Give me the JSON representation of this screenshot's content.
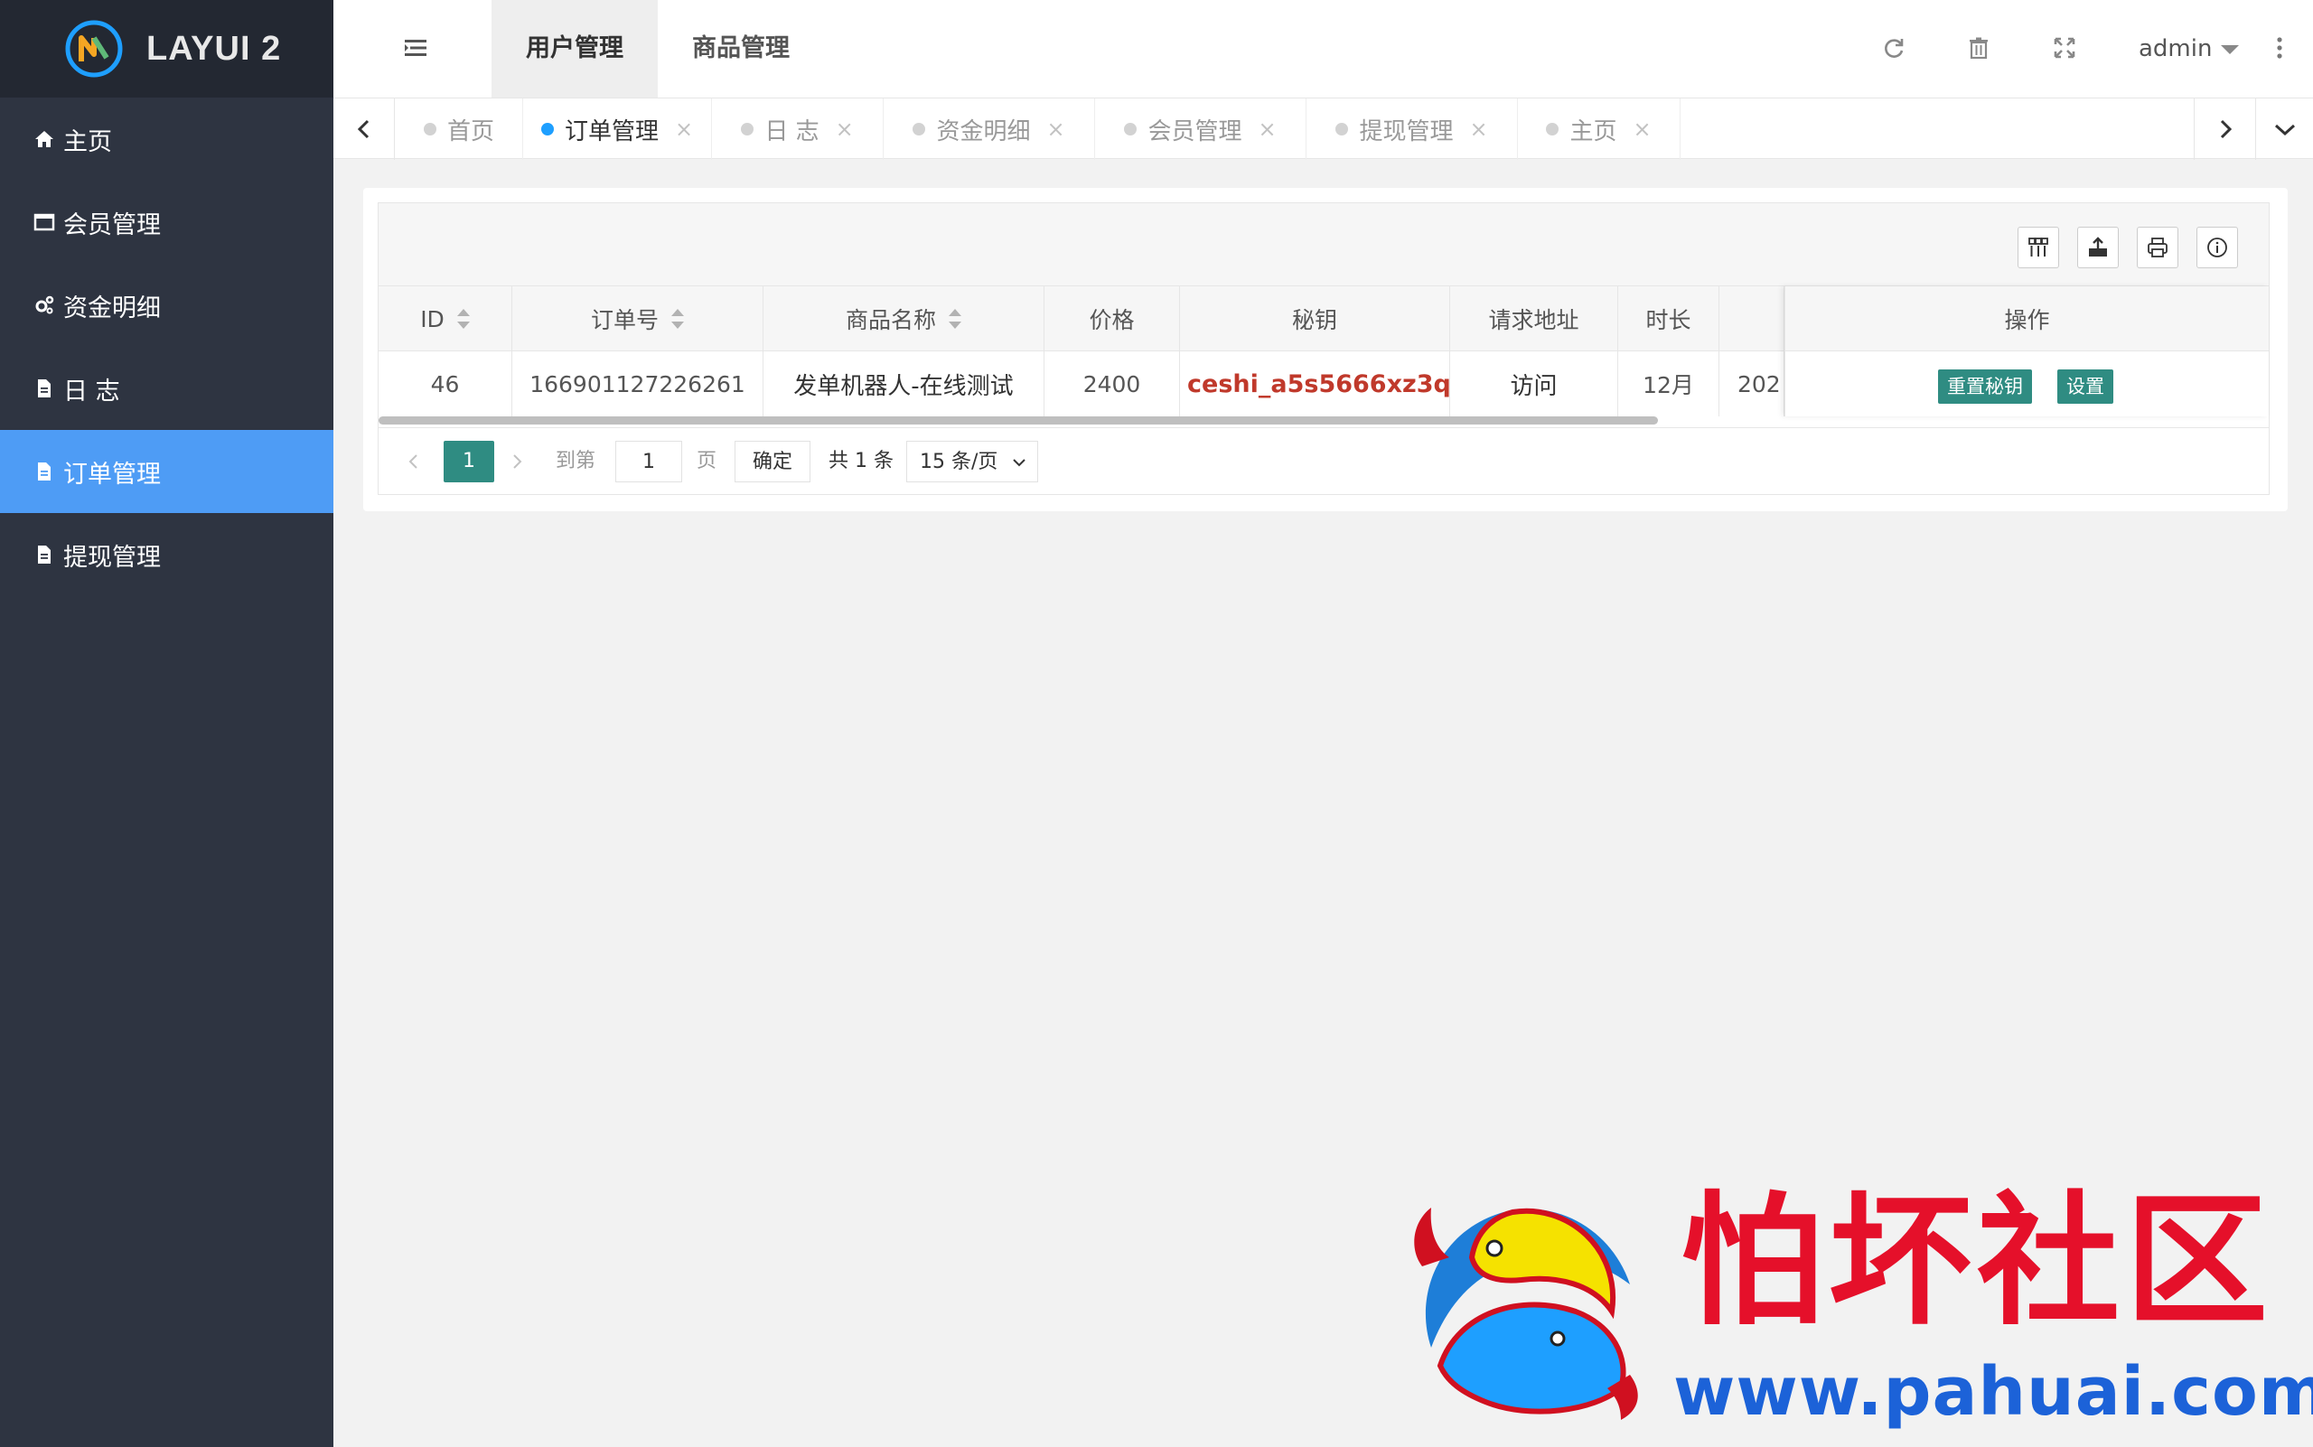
{
  "app": {
    "brand": "LAYUI 2"
  },
  "sidebar": {
    "items": [
      {
        "label": "主页",
        "icon": "home-icon",
        "active": false
      },
      {
        "label": "会员管理",
        "icon": "window-icon",
        "active": false
      },
      {
        "label": "资金明细",
        "icon": "gears-icon",
        "active": false
      },
      {
        "label": "日 志",
        "icon": "file-icon",
        "active": false
      },
      {
        "label": "订单管理",
        "icon": "file-icon",
        "active": true
      },
      {
        "label": "提现管理",
        "icon": "file-icon",
        "active": false
      }
    ]
  },
  "header": {
    "tabs": [
      {
        "label": "用户管理",
        "active": true
      },
      {
        "label": "商品管理",
        "active": false
      }
    ],
    "user": "admin",
    "icons": [
      "refresh-icon",
      "trash-icon",
      "fullscreen-icon",
      "more-icon"
    ]
  },
  "page_tabs": [
    {
      "label": "首页",
      "closable": false,
      "active": false
    },
    {
      "label": "订单管理",
      "closable": true,
      "active": true
    },
    {
      "label": "日 志",
      "closable": true,
      "active": false
    },
    {
      "label": "资金明细",
      "closable": true,
      "active": false
    },
    {
      "label": "会员管理",
      "closable": true,
      "active": false
    },
    {
      "label": "提现管理",
      "closable": true,
      "active": false
    },
    {
      "label": "主页",
      "closable": true,
      "active": false
    }
  ],
  "table": {
    "toolbar_icons": [
      "columns-icon",
      "export-icon",
      "print-icon",
      "info-icon"
    ],
    "columns": [
      "ID",
      "订单号",
      "商品名称",
      "价格",
      "秘钥",
      "请求地址",
      "时长",
      "",
      "操作"
    ],
    "rows": [
      {
        "id": "46",
        "order_no": "166901127226261",
        "product": "发单机器人-在线测试",
        "price": "2400",
        "secret": "ceshi_a5s5666xz3q...",
        "url": "访问",
        "duration": "12月",
        "created": "202",
        "actions": [
          "重置秘钥",
          "设置"
        ]
      }
    ]
  },
  "pager": {
    "current": "1",
    "goto_label": "到第",
    "goto_value": "1",
    "page_unit": "页",
    "confirm": "确定",
    "total": "共 1 条",
    "page_size": "15 条/页"
  },
  "watermark": {
    "title": "怕坏社区",
    "url": "www.pahuai.com"
  },
  "colors": {
    "sidebar_bg": "#2e3441",
    "logo_bg": "#232832",
    "sidebar_active": "#4e9cf5",
    "primary_green": "#2f8c82",
    "secret_red": "#c0392b",
    "tab_dot_active": "#1e9fff"
  }
}
